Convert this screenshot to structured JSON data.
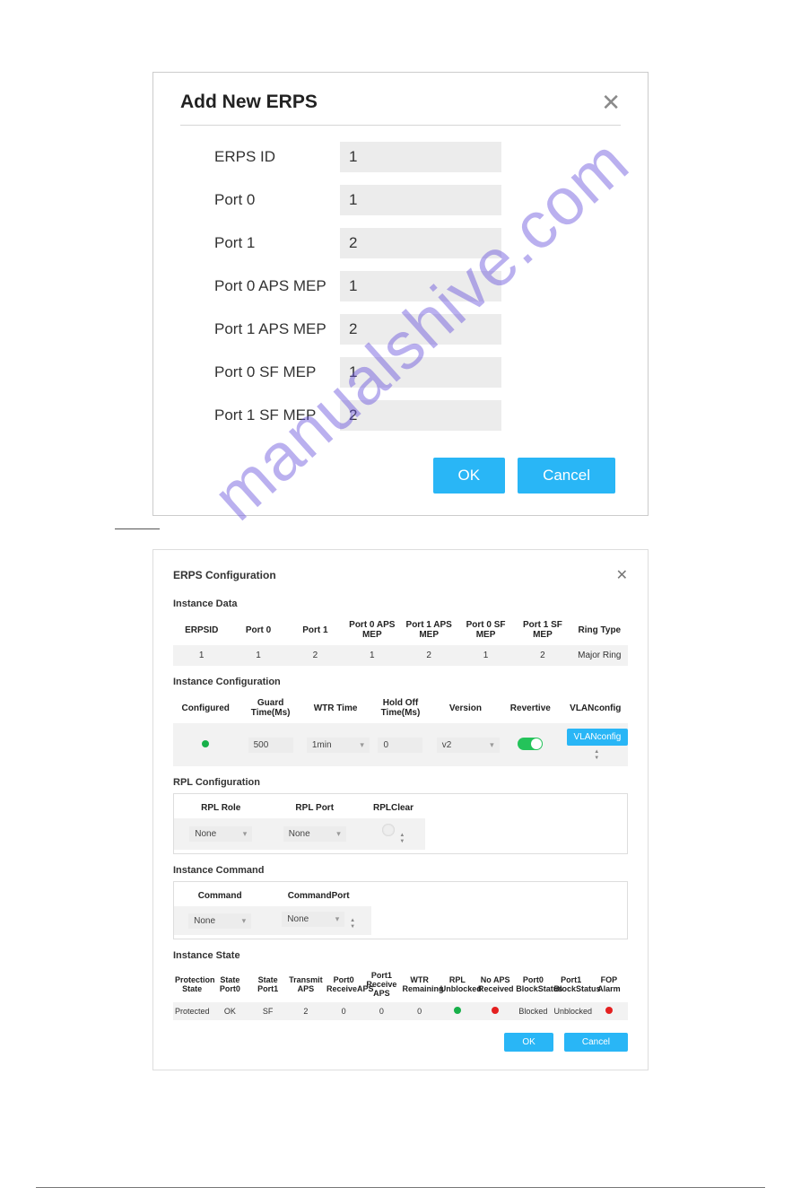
{
  "watermark": "manualshive.com",
  "dialog1": {
    "title": "Add New ERPS",
    "fields": {
      "erps_id": {
        "label": "ERPS ID",
        "value": "1"
      },
      "port0": {
        "label": "Port 0",
        "value": "1"
      },
      "port1": {
        "label": "Port 1",
        "value": "2"
      },
      "p0aps": {
        "label": "Port 0 APS MEP",
        "value": "1"
      },
      "p1aps": {
        "label": "Port 1 APS MEP",
        "value": "2"
      },
      "p0sf": {
        "label": "Port 0 SF MEP",
        "value": "1"
      },
      "p1sf": {
        "label": "Port 1 SF MEP",
        "value": "2"
      }
    },
    "buttons": {
      "ok": "OK",
      "cancel": "Cancel"
    }
  },
  "dialog2": {
    "title": "ERPS Configuration",
    "instance_data": {
      "title": "Instance Data",
      "headers": [
        "ERPSID",
        "Port 0",
        "Port 1",
        "Port 0 APS MEP",
        "Port 1 APS MEP",
        "Port 0 SF MEP",
        "Port 1 SF MEP",
        "Ring Type"
      ],
      "row": [
        "1",
        "1",
        "2",
        "1",
        "2",
        "1",
        "2",
        "Major Ring"
      ]
    },
    "instance_config": {
      "title": "Instance Configuration",
      "headers": [
        "Configured",
        "Guard Time(Ms)",
        "WTR Time",
        "Hold Off Time(Ms)",
        "Version",
        "Revertive",
        "VLANconfig"
      ],
      "row": {
        "configured_dot": "green",
        "guard": "500",
        "wtr": "1min",
        "hold": "0",
        "version": "v2",
        "revertive": "on",
        "vlan_btn": "VLANconfig"
      }
    },
    "rpl": {
      "title": "RPL Configuration",
      "headers": [
        "RPL Role",
        "RPL Port",
        "RPLClear"
      ],
      "row": {
        "role": "None",
        "port": "None"
      }
    },
    "cmd": {
      "title": "Instance Command",
      "headers": [
        "Command",
        "CommandPort"
      ],
      "row": {
        "cmd": "None",
        "cport": "None"
      }
    },
    "state": {
      "title": "Instance State",
      "headers": [
        "Protection State",
        "State Port0",
        "State Port1",
        "Transmit APS",
        "Port0 ReceiveAPS",
        "Port1 Receive APS",
        "WTR Remaining",
        "RPL Unblocked",
        "No APS Received",
        "Port0 BlockStatus",
        "Port1 BlockStatus",
        "FOP Alarm"
      ],
      "row": {
        "prot": "Protected",
        "sp0": "OK",
        "sp1": "SF",
        "taps": "2",
        "p0r": "0",
        "p1r": "0",
        "wtrr": "0",
        "rplu_dot": "green",
        "noaps_dot": "red",
        "p0bs": "Blocked",
        "p1bs": "Unblocked",
        "fop_dot": "red"
      }
    },
    "buttons": {
      "ok": "OK",
      "cancel": "Cancel"
    }
  }
}
